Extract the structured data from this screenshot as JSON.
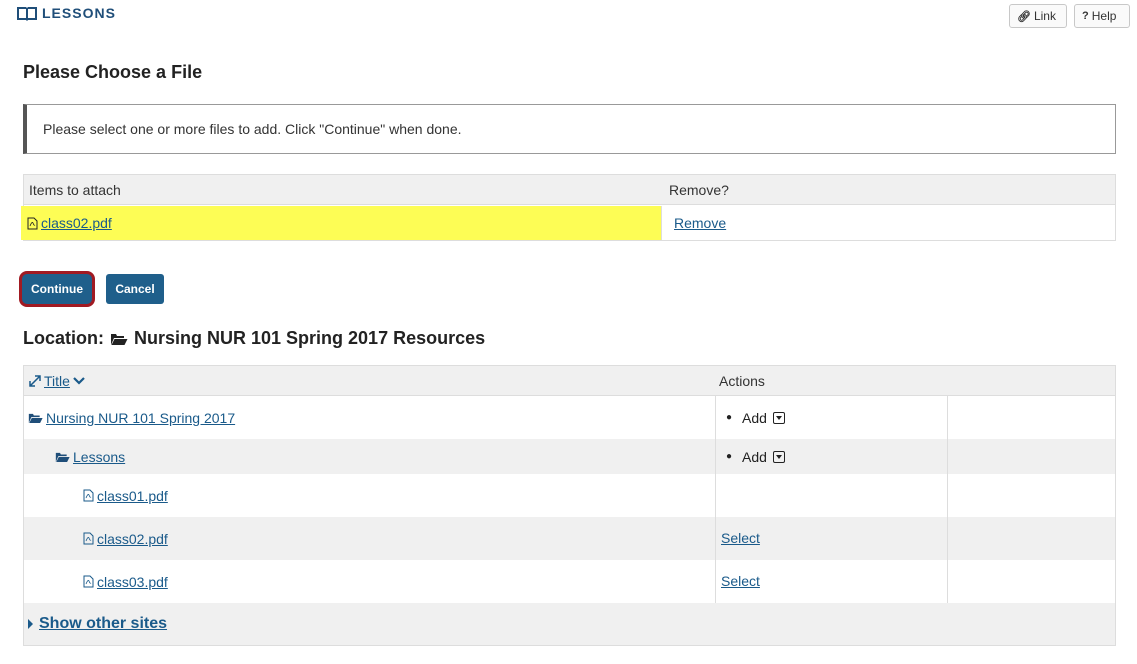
{
  "header": {
    "tool_name": "LESSONS",
    "link_label": "Link",
    "help_label": "Help"
  },
  "page_title": "Please Choose a File",
  "instruction": "Please select one or more files to add. Click \"Continue\" when done.",
  "attach_table": {
    "col_items": "Items to attach",
    "col_remove": "Remove?",
    "rows": [
      {
        "file": "class02.pdf",
        "remove_label": "Remove"
      }
    ]
  },
  "buttons": {
    "continue": "Continue",
    "cancel": "Cancel"
  },
  "location": {
    "label": "Location:",
    "name": "Nursing NUR 101 Spring 2017 Resources"
  },
  "resource_table": {
    "col_title": "Title",
    "col_actions": "Actions",
    "rows": [
      {
        "name": "Nursing NUR 101 Spring 2017",
        "type": "folder",
        "action": "Add"
      },
      {
        "name": "Lessons",
        "type": "folder",
        "action": "Add"
      },
      {
        "name": "class01.pdf",
        "type": "file",
        "action": ""
      },
      {
        "name": "class02.pdf",
        "type": "file",
        "action": "Select"
      },
      {
        "name": "class03.pdf",
        "type": "file",
        "action": "Select"
      }
    ],
    "show_other_sites": "Show other sites"
  },
  "colors": {
    "accent": "#1f5f8b",
    "highlight": "#fdfd55",
    "focus_ring": "#a11a22",
    "link": "#1a5a8a"
  }
}
